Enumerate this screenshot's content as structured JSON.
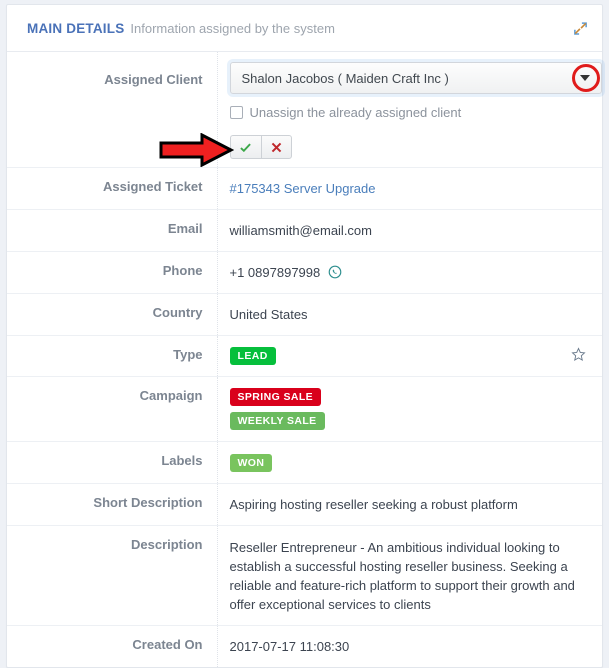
{
  "header": {
    "title": "MAIN DETAILS",
    "subtitle": "Information assigned by the system",
    "expand_icon": "expand-diagonal-icon"
  },
  "colors": {
    "accent": "#4a72b8",
    "link": "#4a7ebb",
    "badge_lead": "#06bf3c",
    "badge_spring_sale": "#d9001b",
    "badge_weekly_sale": "#6aba5e",
    "badge_won": "#79c45e",
    "annotation_red": "#e01b1b",
    "check_green": "#3ca84a",
    "cross_red": "#c0282c",
    "whatsapp": "#2f8f8f"
  },
  "assigned_client": {
    "label": "Assigned Client",
    "selected_option": "Shalon Jacobos ( Maiden Craft Inc )",
    "caret_icon": "chevron-down-icon",
    "unassign_checkbox": {
      "label": "Unassign the already assigned client",
      "checked": false
    },
    "confirm_label": "✔",
    "cancel_label": "✖"
  },
  "rows": [
    {
      "label": "Assigned Ticket",
      "value": "#175343 Server Upgrade",
      "type": "link"
    },
    {
      "label": "Email",
      "value": "williamsmith@email.com",
      "type": "text"
    },
    {
      "label": "Phone",
      "value": "+1 0897897998",
      "type": "phone",
      "icon": "whatsapp-icon"
    },
    {
      "label": "Country",
      "value": "United States",
      "type": "text"
    },
    {
      "label": "Type",
      "value": "LEAD",
      "type": "badge",
      "star_icon": "star-outline-icon"
    },
    {
      "label": "Campaign",
      "value": [
        "SPRING SALE",
        "WEEKLY SALE"
      ],
      "type": "badges"
    },
    {
      "label": "Labels",
      "value": "WON",
      "type": "badge"
    },
    {
      "label": "Short Description",
      "value": "Aspiring hosting reseller seeking a robust platform",
      "type": "text"
    },
    {
      "label": "Description",
      "value": "Reseller Entrepreneur - An ambitious individual looking to establish a successful hosting reseller business. Seeking a reliable and feature-rich platform to support their growth and offer exceptional services to clients",
      "type": "text"
    },
    {
      "label": "Created On",
      "value": "2017-07-17 11:08:30",
      "type": "text"
    }
  ],
  "row_labels": {
    "assigned_ticket": "Assigned Ticket",
    "email": "Email",
    "phone": "Phone",
    "country": "Country",
    "type": "Type",
    "campaign": "Campaign",
    "labels": "Labels",
    "short_description": "Short Description",
    "description": "Description",
    "created_on": "Created On"
  },
  "row_values": {
    "assigned_ticket": "#175343 Server Upgrade",
    "email": "williamsmith@email.com",
    "phone": "+1 0897897998",
    "country": "United States",
    "type_badge": "LEAD",
    "campaign_badge_1": "SPRING SALE",
    "campaign_badge_2": "WEEKLY SALE",
    "labels_badge": "WON",
    "short_description": "Aspiring hosting reseller seeking a robust platform",
    "description": "Reseller Entrepreneur - An ambitious individual looking to establish a successful hosting reseller business. Seeking a reliable and feature-rich platform to support their growth and offer exceptional services to clients",
    "created_on": "2017-07-17 11:08:30"
  },
  "annotations": {
    "circle_target": "dropdown-caret",
    "arrow_target": "confirm-cancel-buttons"
  }
}
